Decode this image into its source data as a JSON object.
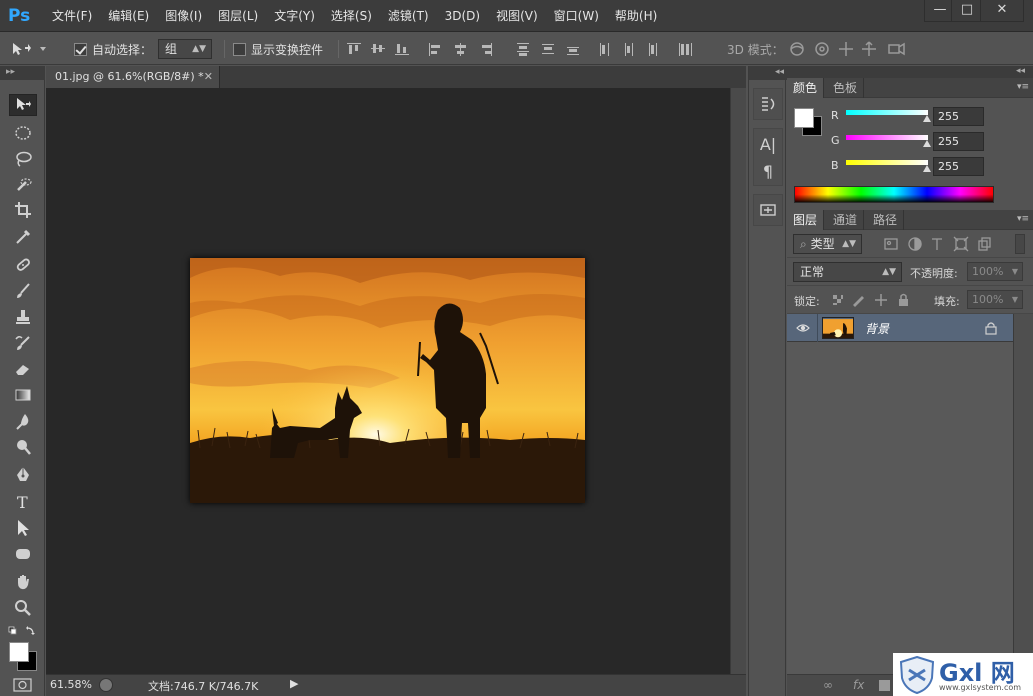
{
  "app": {
    "logo": "Ps"
  },
  "menu": [
    "文件(F)",
    "编辑(E)",
    "图像(I)",
    "图层(L)",
    "文字(Y)",
    "选择(S)",
    "滤镜(T)",
    "3D(D)",
    "视图(V)",
    "窗口(W)",
    "帮助(H)"
  ],
  "window_controls": {
    "minimize": "—",
    "maximize": "□",
    "close": "✕"
  },
  "options": {
    "auto_select_label": "自动选择：",
    "auto_select_checked": true,
    "auto_select_value": "组",
    "show_transform_label": "显示变换控件",
    "show_transform_checked": false,
    "mode_3d_label": "3D 模式："
  },
  "document": {
    "tab_title": "01.jpg @ 61.6%(RGB/8#) *",
    "zoom": "61.58%",
    "doc_info": "文档:746.7 K/746.7K"
  },
  "color_panel": {
    "tabs": [
      "颜色",
      "色板"
    ],
    "channels": [
      {
        "label": "R",
        "value": "255",
        "color": "#00e5ff"
      },
      {
        "label": "G",
        "value": "255",
        "color": "#ff33ff"
      },
      {
        "label": "B",
        "value": "255",
        "color": "#ffff33"
      }
    ],
    "foreground": "#ffffff",
    "background": "#000000"
  },
  "layers_panel": {
    "tabs": [
      "图层",
      "通道",
      "路径"
    ],
    "filter_kind": "类型",
    "blend_mode": "正常",
    "opacity_label": "不透明度:",
    "opacity_value": "100%",
    "lock_label": "锁定:",
    "fill_label": "填充:",
    "fill_value": "100%",
    "layers": [
      {
        "name": "背景",
        "visible": true,
        "locked": true
      }
    ],
    "footer_fx": "fx"
  },
  "watermark": {
    "text": "Gxl 网",
    "url": "www.gxlsystem.com"
  }
}
